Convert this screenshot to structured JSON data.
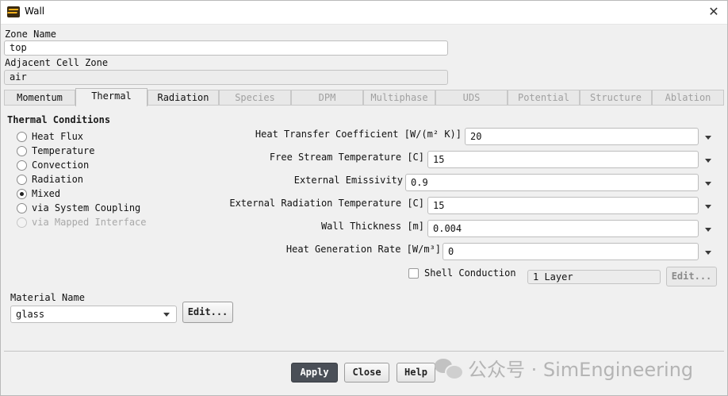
{
  "window": {
    "title": "Wall",
    "close_glyph": "✕"
  },
  "zone": {
    "zone_name_label": "Zone Name",
    "zone_name_value": "top",
    "adjacent_label": "Adjacent Cell Zone",
    "adjacent_value": "air"
  },
  "tabs": [
    {
      "label": "Momentum",
      "state": "enabled"
    },
    {
      "label": "Thermal",
      "state": "active"
    },
    {
      "label": "Radiation",
      "state": "enabled"
    },
    {
      "label": "Species",
      "state": "disabled"
    },
    {
      "label": "DPM",
      "state": "disabled"
    },
    {
      "label": "Multiphase",
      "state": "disabled"
    },
    {
      "label": "UDS",
      "state": "disabled"
    },
    {
      "label": "Potential",
      "state": "disabled"
    },
    {
      "label": "Structure",
      "state": "disabled"
    },
    {
      "label": "Ablation",
      "state": "disabled"
    }
  ],
  "thermal": {
    "section_title": "Thermal Conditions",
    "options": [
      {
        "label": "Heat Flux",
        "selected": false,
        "enabled": true
      },
      {
        "label": "Temperature",
        "selected": false,
        "enabled": true
      },
      {
        "label": "Convection",
        "selected": false,
        "enabled": true
      },
      {
        "label": "Radiation",
        "selected": false,
        "enabled": true
      },
      {
        "label": "Mixed",
        "selected": true,
        "enabled": true
      },
      {
        "label": "via System Coupling",
        "selected": false,
        "enabled": true
      },
      {
        "label": "via Mapped Interface",
        "selected": false,
        "enabled": false
      }
    ],
    "params": [
      {
        "label": "Heat Transfer Coefficient [W/(m² K)]",
        "value": "20"
      },
      {
        "label": "Free Stream Temperature [C]",
        "value": "15"
      },
      {
        "label": "External Emissivity",
        "value": "0.9"
      },
      {
        "label": "External Radiation Temperature [C]",
        "value": "15"
      },
      {
        "label": "Wall Thickness [m]",
        "value": "0.004"
      },
      {
        "label": "Heat Generation Rate [W/m³]",
        "value": "0"
      }
    ],
    "shell_conduction_label": "Shell Conduction",
    "layers_value": "1 Layer",
    "layers_edit_label": "Edit..."
  },
  "material": {
    "label": "Material Name",
    "value": "glass",
    "edit_label": "Edit..."
  },
  "footer": {
    "apply_label": "Apply",
    "close_label": "Close",
    "help_label": "Help"
  },
  "watermark": {
    "text": "公众号 · SimEngineering"
  },
  "colors": {
    "accent_icon": "#f3b11b",
    "primary_button": "#4a4f57"
  }
}
